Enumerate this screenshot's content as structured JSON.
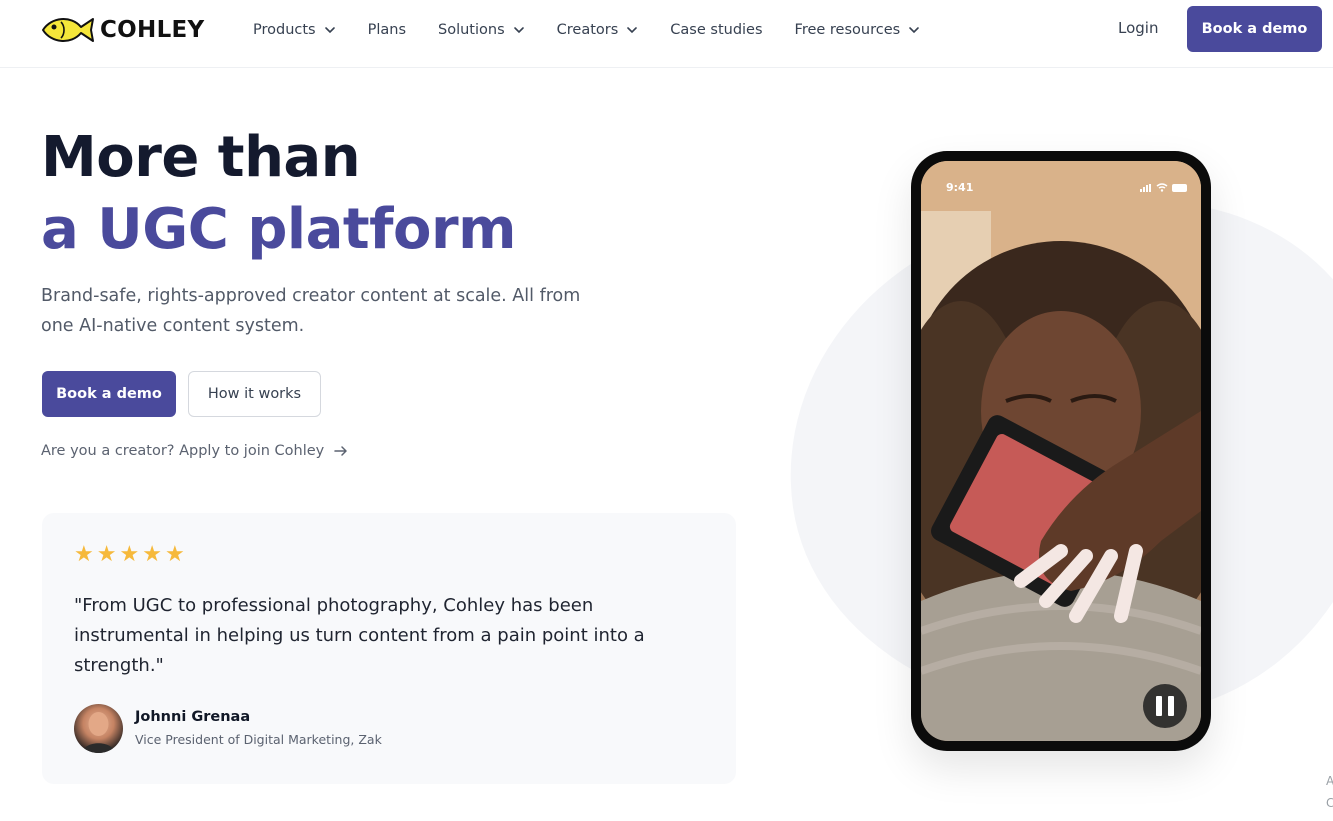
{
  "brand": {
    "name": "COHLEY",
    "logo_icon": "fish-icon",
    "accent": "#4a4a9c",
    "logo_color": "#f5e63a"
  },
  "nav": {
    "items": [
      {
        "label": "Products",
        "dropdown": true
      },
      {
        "label": "Plans",
        "dropdown": false
      },
      {
        "label": "Solutions",
        "dropdown": true
      },
      {
        "label": "Creators",
        "dropdown": true
      },
      {
        "label": "Case studies",
        "dropdown": false
      },
      {
        "label": "Free resources",
        "dropdown": true
      }
    ],
    "login": "Login",
    "cta": "Book a demo"
  },
  "hero": {
    "title_line1": "More than",
    "title_line2": "a UGC platform",
    "subtitle": "Brand-safe, rights-approved creator content at scale. All from one AI-native content system.",
    "primary_cta": "Book a demo",
    "secondary_cta": "How it works",
    "creator_link": "Are you a creator? Apply to join Cohley"
  },
  "testimonial": {
    "stars": 5,
    "star_color": "#f6b93b",
    "quote": "\"From UGC to professional photography, Cohley has been instrumental in helping us turn content from a pain point into a strength.\"",
    "author_name": "Johnni Grenaa",
    "author_role": "Vice President of Digital Marketing, Zak"
  },
  "phone": {
    "status_time": "9:41",
    "video_state": "playing",
    "control_icon": "pause-icon"
  },
  "edge_text": "A\nC"
}
